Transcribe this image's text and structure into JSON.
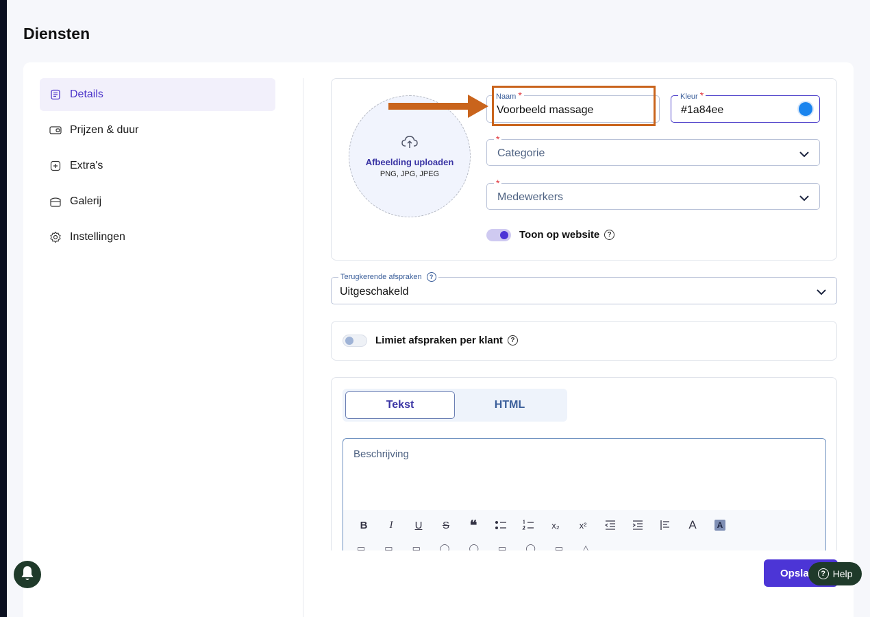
{
  "page": {
    "title": "Diensten"
  },
  "sidebar": {
    "items": [
      {
        "label": "Details",
        "icon": "document-icon",
        "active": true
      },
      {
        "label": "Prijzen & duur",
        "icon": "wallet-icon",
        "active": false
      },
      {
        "label": "Extra's",
        "icon": "plus-square-icon",
        "active": false
      },
      {
        "label": "Galerij",
        "icon": "gallery-icon",
        "active": false
      },
      {
        "label": "Instellingen",
        "icon": "gear-icon",
        "active": false
      }
    ]
  },
  "upload": {
    "title": "Afbeelding uploaden",
    "formats": "PNG, JPG, JPEG"
  },
  "fields": {
    "naam": {
      "label": "Naam",
      "required": "*",
      "value": "Voorbeeld massage"
    },
    "kleur": {
      "label": "Kleur",
      "required": "*",
      "value": "#1a84ee",
      "swatch": "#1a84ee"
    },
    "categorie": {
      "required": "*",
      "placeholder": "Categorie"
    },
    "medewerkers": {
      "required": "*",
      "placeholder": "Medewerkers"
    }
  },
  "toon_op_website": {
    "label": "Toon op website",
    "enabled": true
  },
  "terugkerend": {
    "label": "Terugkerende afspraken",
    "value": "Uitgeschakeld"
  },
  "limiet": {
    "label": "Limiet afspraken per klant",
    "enabled": false
  },
  "editor": {
    "tabs": [
      {
        "label": "Tekst",
        "active": true
      },
      {
        "label": "HTML",
        "active": false
      }
    ],
    "placeholder": "Beschrijving",
    "toolbar": {
      "bold": "B",
      "italic": "I",
      "underline": "U",
      "strike": "S",
      "quote": "❝",
      "subscript": "x₂",
      "superscript": "x²",
      "font_color": "A",
      "highlight": "A"
    }
  },
  "actions": {
    "save_label": "Opsla",
    "help_label": "Help"
  },
  "colors": {
    "accent": "#4c35d6",
    "annotation": "#c9641c",
    "help_bg": "#1f3a2a"
  }
}
